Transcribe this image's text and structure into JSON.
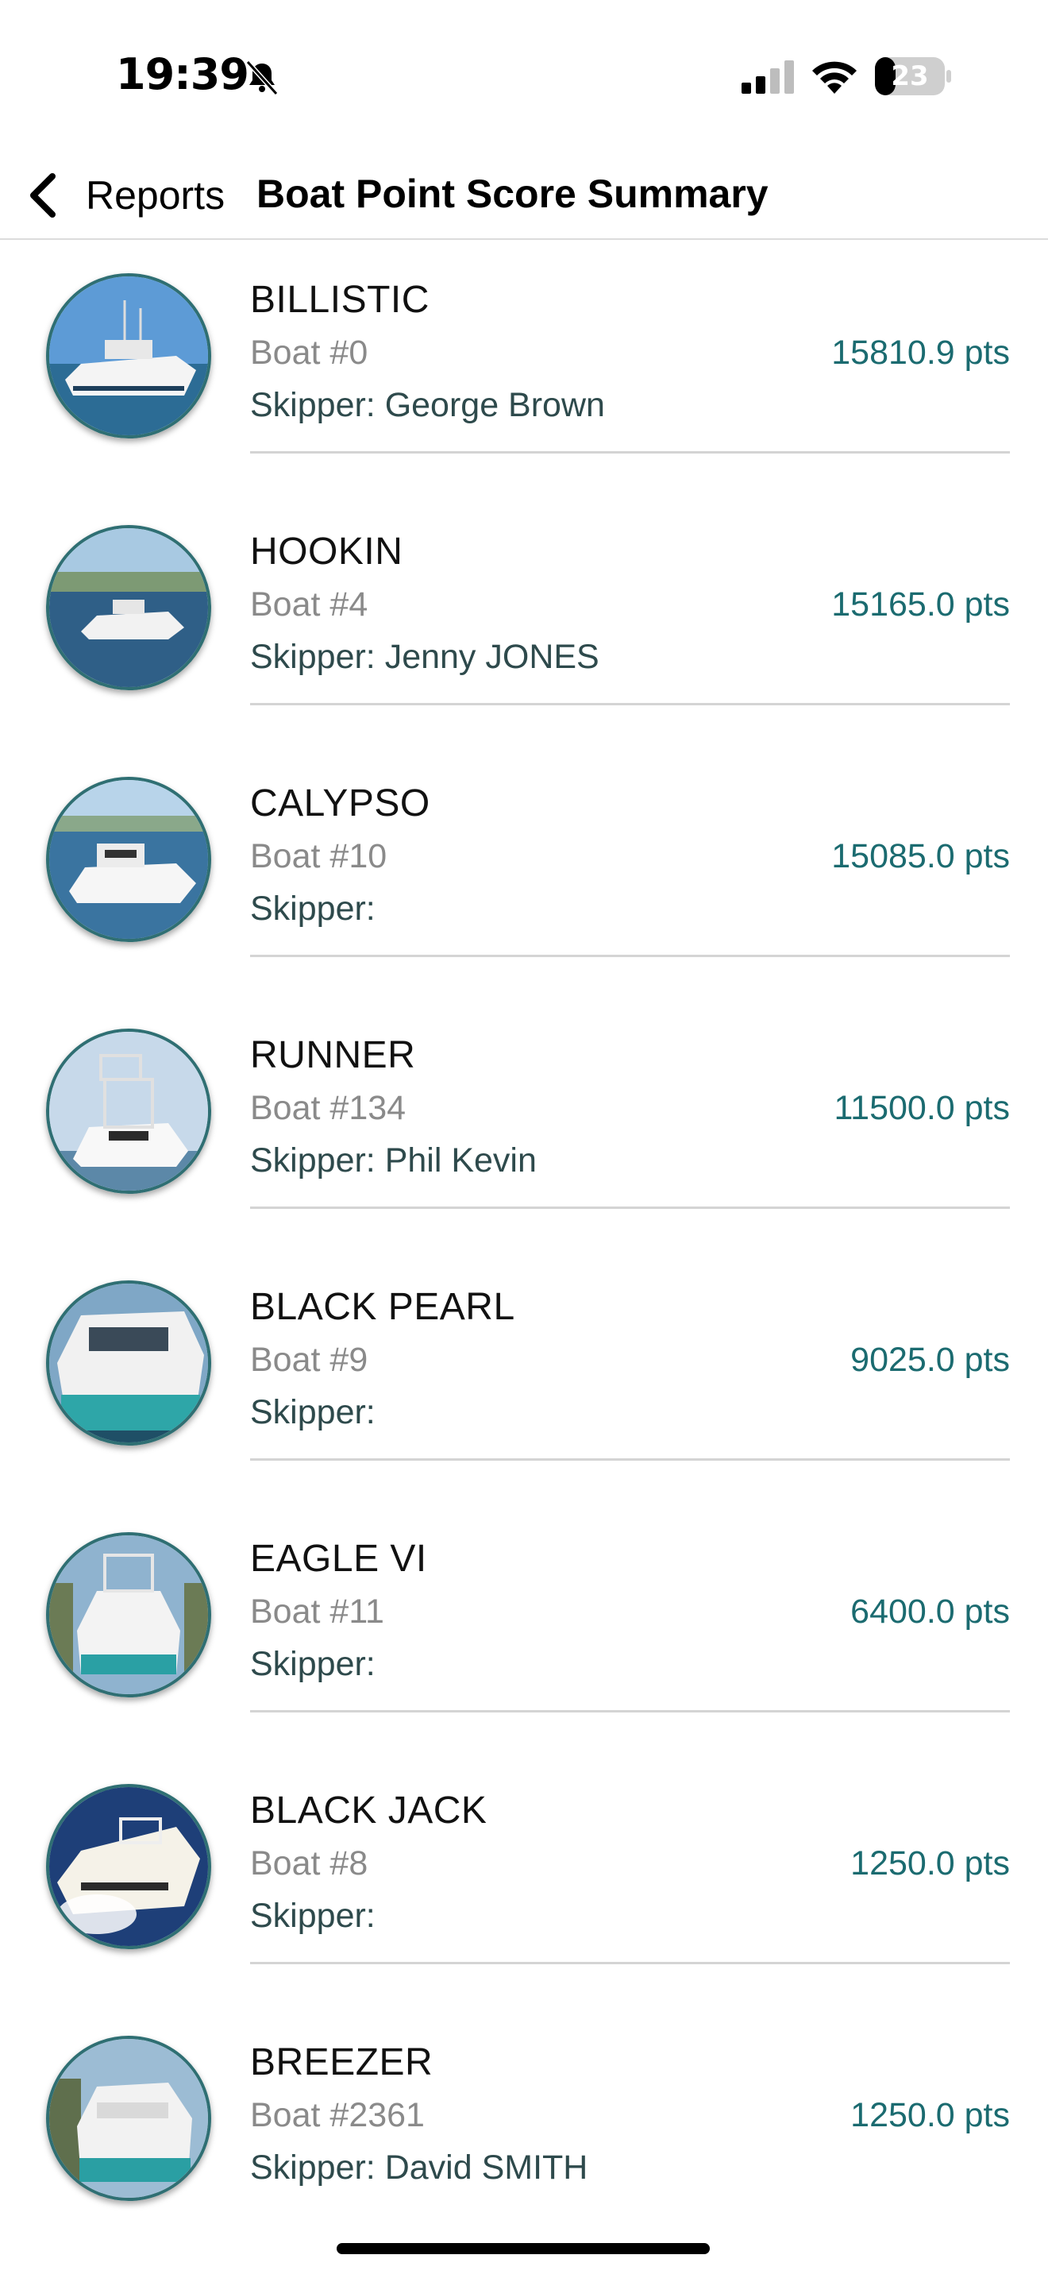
{
  "status_bar": {
    "time": "19:39",
    "battery": "23"
  },
  "nav": {
    "back_label": "Reports",
    "title": "Boat Point Score Summary"
  },
  "boats": [
    {
      "name": "BILLISTIC",
      "number": "Boat #0",
      "skipper": "Skipper: George Brown",
      "points": "15810.9 pts"
    },
    {
      "name": "HOOKIN",
      "number": "Boat #4",
      "skipper": "Skipper: Jenny JONES",
      "points": "15165.0 pts"
    },
    {
      "name": "CALYPSO",
      "number": "Boat #10",
      "skipper": "Skipper:",
      "points": "15085.0 pts"
    },
    {
      "name": "RUNNER",
      "number": "Boat #134",
      "skipper": "Skipper: Phil Kevin",
      "points": "11500.0 pts"
    },
    {
      "name": "BLACK PEARL",
      "number": "Boat #9",
      "skipper": "Skipper:",
      "points": "9025.0 pts"
    },
    {
      "name": "EAGLE VI",
      "number": "Boat #11",
      "skipper": "Skipper:",
      "points": "6400.0 pts"
    },
    {
      "name": "BLACK JACK",
      "number": "Boat #8",
      "skipper": "Skipper:",
      "points": "1250.0 pts"
    },
    {
      "name": "BREEZER",
      "number": "Boat #2361",
      "skipper": "Skipper: David SMITH",
      "points": "1250.0 pts"
    }
  ],
  "colors": {
    "accent": "#1b6b70",
    "skipper_text": "#2e4a4c",
    "muted_text": "#8a8a8a",
    "avatar_border": "#2f6f73"
  }
}
